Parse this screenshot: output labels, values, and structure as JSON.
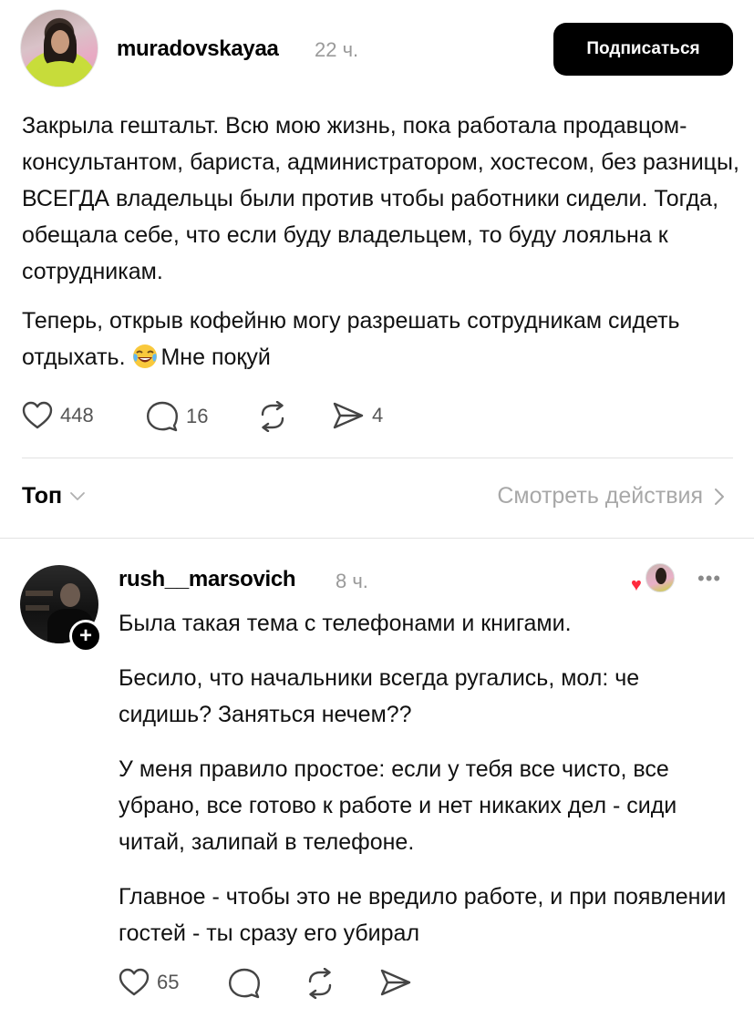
{
  "post": {
    "author": "muradovskayaa",
    "time": "22 ч.",
    "subscribe_label": "Подписаться",
    "paragraphs": [
      "Закрыла гештальт. Всю мою жизнь, пока работала продавцом-консультантом, бариста, администратором, хостесом, без разницы, ВСЕГДА владельцы были против чтобы работники сидели. Тогда, обещала себе, что если буду владельцем, то буду лояльна к сотрудникам.",
      "Теперь, открыв кофейню могу разрешать сотрудникам сидеть отдыхать."
    ],
    "paragraph_tail": "Мне поқуй",
    "emoji": "😂",
    "likes": "448",
    "comments": "16",
    "shares": "4"
  },
  "replies_bar": {
    "sort_label": "Топ",
    "view_activity_label": "Смотреть действия"
  },
  "reply": {
    "author": "rush__marsovich",
    "time": "8 ч.",
    "paragraphs": [
      "Была такая тема с телефонами и книгами.",
      "Бесило, что начальники всегда ругались, мол: че сидишь? Заняться нечем??",
      "У меня правило простое: если у тебя все чисто, все убрано, все готово к работе и нет никаких дел - сиди читай, залипай в телефоне.",
      "Главное - чтобы это не вредило работе, и при появлении гостей - ты сразу его убирал"
    ],
    "likes": "65",
    "follow_symbol": "+",
    "more_symbol": "•••"
  },
  "icons": {
    "like": "heart-icon",
    "comment": "comment-bubble-icon",
    "repost": "repost-icon",
    "share": "send-icon",
    "emoji": "face-with-tears-of-joy-icon"
  },
  "colors": {
    "accent": "#000000",
    "muted": "#9a9a9a",
    "liked_heart": "#ff2a3d"
  }
}
